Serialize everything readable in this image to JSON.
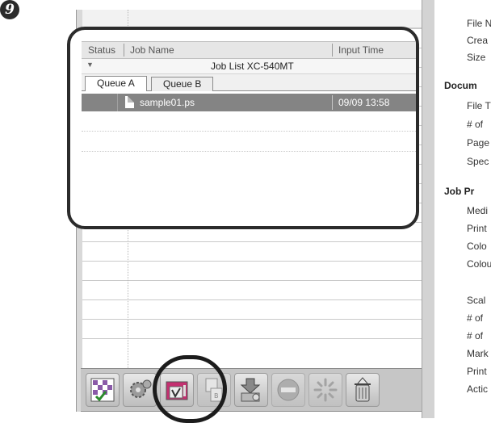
{
  "step_marker": "9",
  "job_list": {
    "columns": [
      "Status",
      "Job Name",
      "Input Time"
    ],
    "title": "Job List XC-540MT",
    "tabs": [
      {
        "label": "Queue A",
        "active": true
      },
      {
        "label": "Queue B",
        "active": false
      }
    ],
    "jobs": [
      {
        "name": "sample01.ps",
        "input_time": "09/09 13:58",
        "selected": true
      }
    ]
  },
  "properties": {
    "items_1": [
      "File N",
      "Crea",
      "Size"
    ],
    "section_document": "Docum",
    "items_2": [
      "File T",
      "# of",
      "Page",
      "Spec"
    ],
    "section_job": "Job Pr",
    "items_3": [
      "Medi",
      "Print",
      "Colo",
      "Colou"
    ],
    "items_4": [
      "Scal",
      "# of",
      "# of",
      "Mark",
      "Print",
      "Actic"
    ]
  },
  "toolbar": {
    "buttons": [
      {
        "icon": "layout-grid-icon",
        "enabled": true
      },
      {
        "icon": "gear-settings-icon",
        "enabled": true
      },
      {
        "icon": "print-job-icon",
        "enabled": true,
        "highlighted": true
      },
      {
        "icon": "document-copy-icon",
        "enabled": false
      },
      {
        "icon": "download-to-disk-icon",
        "enabled": true
      },
      {
        "icon": "stop-icon",
        "enabled": false
      },
      {
        "icon": "processing-icon",
        "enabled": false
      },
      {
        "icon": "trash-icon",
        "enabled": true
      }
    ]
  }
}
